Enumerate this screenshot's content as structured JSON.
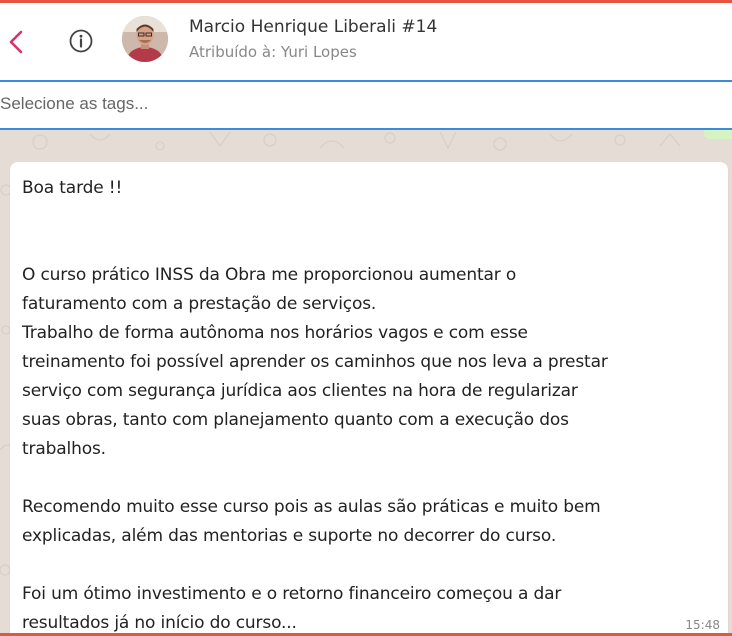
{
  "header": {
    "back_icon": "chevron-left-icon",
    "info_icon": "info-circle-icon",
    "contact_name": "Marcio Henrique Liberali #14",
    "assigned_to": "Atribuído à: Yuri Lopes"
  },
  "tags": {
    "placeholder": "Selecione as tags..."
  },
  "message": {
    "text": "Boa tarde !!\n\n\nO curso prático INSS da Obra  me proporcionou aumentar o\nfaturamento com a prestação de serviços.\nTrabalho de forma autônoma nos horários vagos e com esse\ntreinamento foi possível aprender os caminhos que nos leva a prestar\nserviço com segurança jurídica aos clientes na hora de regularizar\nsuas obras, tanto com planejamento quanto com a execução dos\ntrabalhos.\n\nRecomendo muito esse curso pois as aulas são práticas e muito bem\nexplicadas, além das mentorias e suporte no decorrer do curso.\n\nFoi um ótimo investimento e o retorno financeiro começou a dar\nresultados já no início do curso...",
    "time": "15:48"
  },
  "colors": {
    "accent": "#e8553e",
    "back_icon": "#d6336c",
    "divider": "#3c8bd9",
    "chat_background": "#e5ddd5"
  }
}
